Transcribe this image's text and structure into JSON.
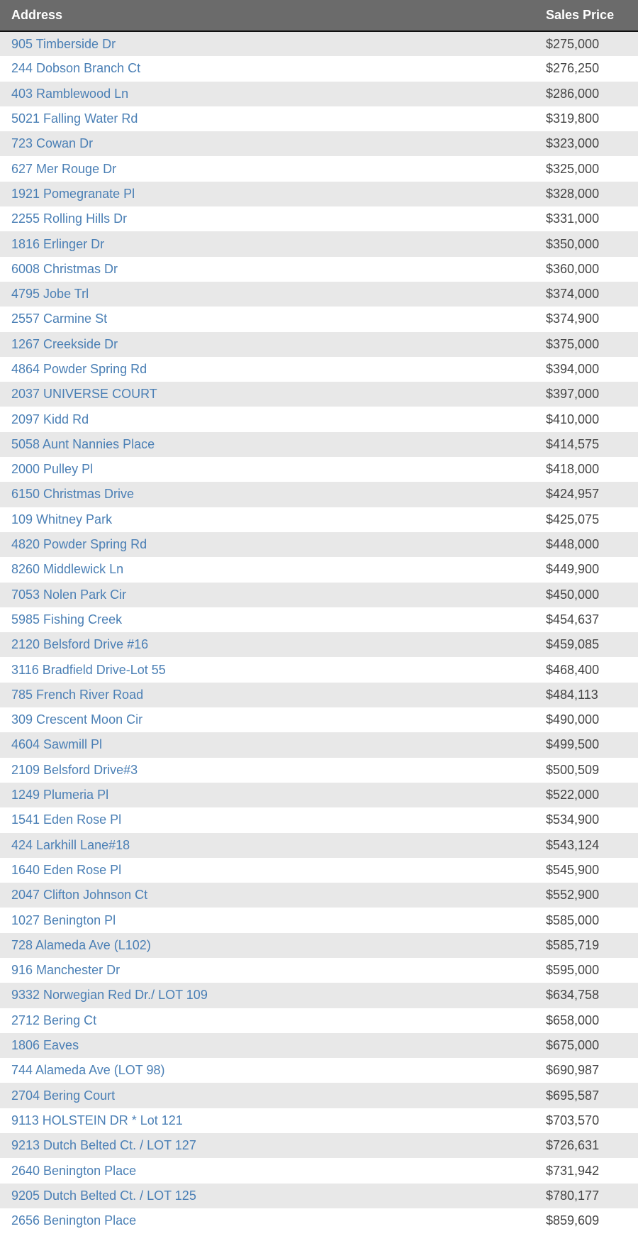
{
  "table": {
    "headers": {
      "address": "Address",
      "sales_price": "Sales Price"
    },
    "colors": {
      "header_bg": "#6b6b6b",
      "header_text": "#ffffff",
      "link": "#4a7fb5",
      "price_text": "#444444",
      "row_alt": "#e8e8e8"
    },
    "rows": [
      {
        "address": "905 Timberside Dr",
        "price": "$275,000"
      },
      {
        "address": "244 Dobson Branch Ct",
        "price": "$276,250"
      },
      {
        "address": "403 Ramblewood Ln",
        "price": "$286,000"
      },
      {
        "address": "5021 Falling Water Rd",
        "price": "$319,800"
      },
      {
        "address": "723 Cowan Dr",
        "price": "$323,000"
      },
      {
        "address": "627 Mer Rouge Dr",
        "price": "$325,000"
      },
      {
        "address": "1921 Pomegranate Pl",
        "price": "$328,000"
      },
      {
        "address": "2255 Rolling Hills Dr",
        "price": "$331,000"
      },
      {
        "address": "1816 Erlinger Dr",
        "price": "$350,000"
      },
      {
        "address": "6008 Christmas Dr",
        "price": "$360,000"
      },
      {
        "address": "4795 Jobe Trl",
        "price": "$374,000"
      },
      {
        "address": "2557 Carmine St",
        "price": "$374,900"
      },
      {
        "address": "1267 Creekside Dr",
        "price": "$375,000"
      },
      {
        "address": "4864 Powder Spring Rd",
        "price": "$394,000"
      },
      {
        "address": "2037 UNIVERSE COURT",
        "price": "$397,000"
      },
      {
        "address": "2097 Kidd Rd",
        "price": "$410,000"
      },
      {
        "address": "5058 Aunt Nannies Place",
        "price": "$414,575"
      },
      {
        "address": "2000 Pulley Pl",
        "price": "$418,000"
      },
      {
        "address": "6150 Christmas Drive",
        "price": "$424,957"
      },
      {
        "address": "109 Whitney Park",
        "price": "$425,075"
      },
      {
        "address": "4820 Powder Spring Rd",
        "price": "$448,000"
      },
      {
        "address": "8260 Middlewick Ln",
        "price": "$449,900"
      },
      {
        "address": "7053 Nolen Park Cir",
        "price": "$450,000"
      },
      {
        "address": "5985 Fishing Creek",
        "price": "$454,637"
      },
      {
        "address": "2120 Belsford Drive #16",
        "price": "$459,085"
      },
      {
        "address": "3116 Bradfield Drive-Lot 55",
        "price": "$468,400"
      },
      {
        "address": "785 French River Road",
        "price": "$484,113"
      },
      {
        "address": "309 Crescent Moon Cir",
        "price": "$490,000"
      },
      {
        "address": "4604 Sawmill Pl",
        "price": "$499,500"
      },
      {
        "address": "2109 Belsford Drive#3",
        "price": "$500,509"
      },
      {
        "address": "1249 Plumeria Pl",
        "price": "$522,000"
      },
      {
        "address": "1541 Eden Rose Pl",
        "price": "$534,900"
      },
      {
        "address": "424 Larkhill Lane#18",
        "price": "$543,124"
      },
      {
        "address": "1640 Eden Rose Pl",
        "price": "$545,900"
      },
      {
        "address": "2047 Clifton Johnson Ct",
        "price": "$552,900"
      },
      {
        "address": "1027 Benington Pl",
        "price": "$585,000"
      },
      {
        "address": "728 Alameda Ave (L102)",
        "price": "$585,719"
      },
      {
        "address": "916 Manchester Dr",
        "price": "$595,000"
      },
      {
        "address": "9332 Norwegian Red Dr./ LOT 109",
        "price": "$634,758"
      },
      {
        "address": "2712 Bering Ct",
        "price": "$658,000"
      },
      {
        "address": "1806 Eaves",
        "price": "$675,000"
      },
      {
        "address": "744 Alameda Ave (LOT 98)",
        "price": "$690,987"
      },
      {
        "address": "2704 Bering Court",
        "price": "$695,587"
      },
      {
        "address": "9113 HOLSTEIN DR * Lot 121",
        "price": "$703,570"
      },
      {
        "address": "9213 Dutch Belted Ct. / LOT 127",
        "price": "$726,631"
      },
      {
        "address": "2640 Benington Place",
        "price": "$731,942"
      },
      {
        "address": "9205 Dutch Belted Ct. / LOT 125",
        "price": "$780,177"
      },
      {
        "address": "2656 Benington Place",
        "price": "$859,609"
      }
    ]
  }
}
